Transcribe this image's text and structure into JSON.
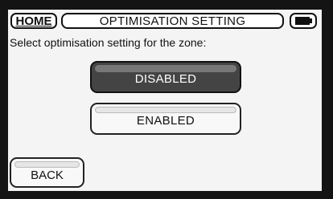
{
  "header": {
    "home_label": "HOME",
    "title": "OPTIMISATION SETTING",
    "battery_icon": "battery-icon"
  },
  "main": {
    "prompt": "Select optimisation setting for the zone:",
    "options": [
      {
        "label": "DISABLED",
        "selected": true
      },
      {
        "label": "ENABLED",
        "selected": false
      }
    ]
  },
  "footer": {
    "back_label": "BACK"
  },
  "colors": {
    "frame": "#141414",
    "screen": "#f4f4f4",
    "selected_button": "#444444",
    "button": "#f8f8f8"
  }
}
